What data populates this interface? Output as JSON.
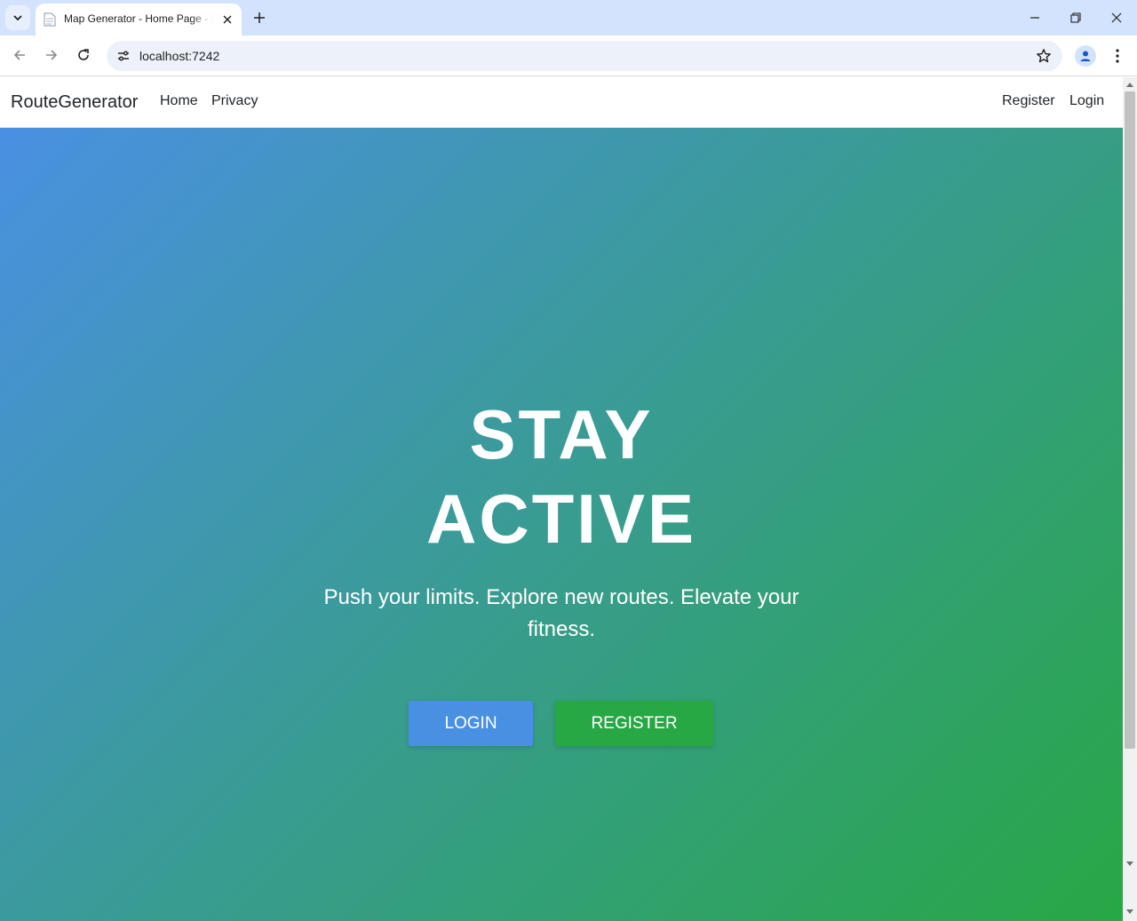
{
  "browser": {
    "tab_title": "Map Generator - Home Page - RouteGenerator",
    "url": "localhost:7242"
  },
  "site": {
    "brand": "RouteGenerator",
    "nav_left": [
      "Home",
      "Privacy"
    ],
    "nav_right": [
      "Register",
      "Login"
    ]
  },
  "hero": {
    "title_line1": "STAY",
    "title_line2": "ACTIVE",
    "subtitle": "Push your limits. Explore new routes. Elevate your fitness.",
    "login_label": "LOGIN",
    "register_label": "REGISTER",
    "gradient_start": "#4a90e2",
    "gradient_end": "#28a745"
  },
  "colors": {
    "login_button": "#4a90e2",
    "register_button": "#28a745",
    "tabstrip": "#d3e3fd"
  },
  "icons": [
    "tab-search-icon",
    "page-favicon-icon",
    "close-icon",
    "plus-icon",
    "minimize-icon",
    "restore-icon",
    "window-close-icon",
    "back-arrow-icon",
    "forward-arrow-icon",
    "reload-icon",
    "site-settings-icon",
    "star-icon",
    "profile-icon",
    "menu-dots-icon",
    "scroll-up-icon",
    "scroll-down-icon"
  ]
}
